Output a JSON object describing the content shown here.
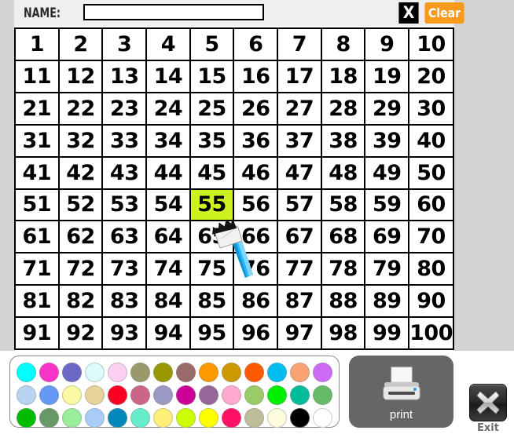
{
  "header": {
    "name_label": "NAME:",
    "name_value": "",
    "name_placeholder": "",
    "close_label": "X",
    "clear_label": "Clear"
  },
  "grid": {
    "rows": [
      [
        1,
        2,
        3,
        4,
        5,
        6,
        7,
        8,
        9,
        10
      ],
      [
        11,
        12,
        13,
        14,
        15,
        16,
        17,
        18,
        19,
        20
      ],
      [
        21,
        22,
        23,
        24,
        25,
        26,
        27,
        28,
        29,
        30
      ],
      [
        31,
        32,
        33,
        34,
        35,
        36,
        37,
        38,
        39,
        40
      ],
      [
        41,
        42,
        43,
        44,
        45,
        46,
        47,
        48,
        49,
        50
      ],
      [
        51,
        52,
        53,
        54,
        55,
        56,
        57,
        58,
        59,
        60
      ],
      [
        61,
        62,
        63,
        64,
        65,
        66,
        67,
        68,
        69,
        70
      ],
      [
        71,
        72,
        73,
        74,
        75,
        76,
        77,
        78,
        79,
        80
      ],
      [
        81,
        82,
        83,
        84,
        85,
        86,
        87,
        88,
        89,
        90
      ],
      [
        91,
        92,
        93,
        94,
        95,
        96,
        97,
        98,
        99,
        100
      ]
    ],
    "highlighted": [
      55
    ],
    "highlight_color": "#ccf21f",
    "cell_background": "#ffffff",
    "border_color": "#000000"
  },
  "cursor": {
    "icon": "paintbrush-icon",
    "handle_color": "#29b6f6",
    "bristle_color": "#111111",
    "ferrule_color": "#e8e8e8"
  },
  "palette": {
    "rows": [
      [
        "#00ffff",
        "#fa34c8",
        "#6a68c4",
        "#dcfbfb",
        "#fcd0f0",
        "#99996b",
        "#989800",
        "#996b6b",
        "#ff9900",
        "#cc9a00",
        "#ff5a00",
        "#00bdf0",
        "#fba273",
        "#cc69f5"
      ],
      [
        "#b9d3f2",
        "#6699f5",
        "#fafaa5",
        "#e8d49a",
        "#fa0022",
        "#cc6688",
        "#9999c4",
        "#cc0099",
        "#96689a",
        "#ffabcf",
        "#99cc66",
        "#00ee00",
        "#00bd99",
        "#66bb66"
      ],
      [
        "#00bb00",
        "#669966",
        "#99ee99",
        "#a8ccf5",
        "#0088bb",
        "#66eecc",
        "#ffee77",
        "#ccff00",
        "#ffff00",
        "#ff1166",
        "#bdbd99",
        "#fdfddd",
        "#000000",
        "#ffffff"
      ]
    ]
  },
  "print": {
    "label": "print",
    "icon": "printer-icon",
    "background": "#666666"
  },
  "exit": {
    "label": "Exit",
    "icon": "close-x-icon"
  }
}
